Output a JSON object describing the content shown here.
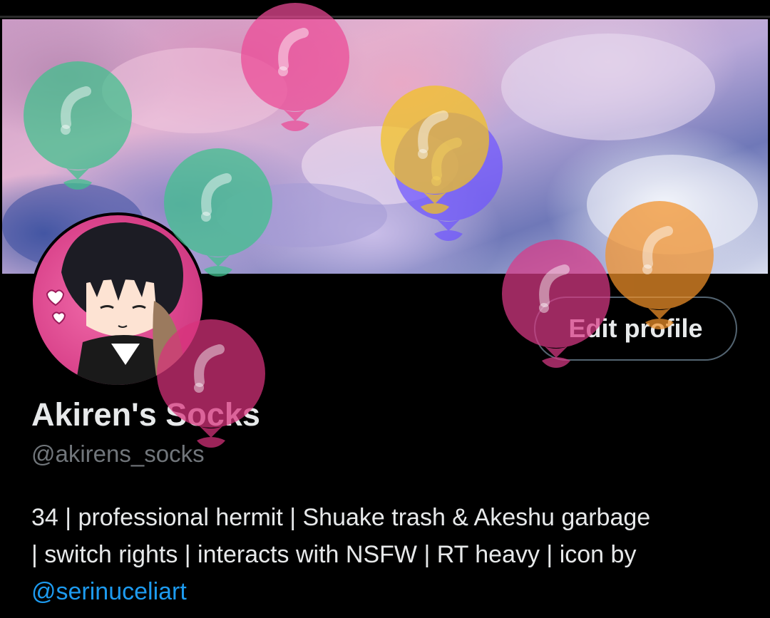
{
  "profile": {
    "display_name": "Akiren's Socks",
    "handle": "@akirens_socks",
    "bio_line1": "34 | professional hermit | Shuake trash & Akeshu garbage",
    "bio_line2": "| switch rights | interacts with NSFW | RT heavy | icon by",
    "bio_mention": "@serinuceliart",
    "edit_button_label": "Edit profile"
  },
  "colors": {
    "background": "#000000",
    "text": "#e7e9ea",
    "secondary_text": "#71767b",
    "link": "#1d9bf0",
    "button_border": "#536471"
  },
  "decorations": {
    "balloons": [
      {
        "color": "#3fc28c",
        "icon": "balloon-icon"
      },
      {
        "color": "#ec4a96",
        "icon": "balloon-icon"
      },
      {
        "color": "#6f55ff",
        "icon": "balloon-icon"
      },
      {
        "color": "#f2c31f",
        "icon": "balloon-icon"
      },
      {
        "color": "#3fc28c",
        "icon": "balloon-icon"
      },
      {
        "color": "#d83a86",
        "icon": "balloon-icon"
      },
      {
        "color": "#f2922a",
        "icon": "balloon-icon"
      },
      {
        "color": "#d8327c",
        "icon": "balloon-icon"
      }
    ]
  }
}
